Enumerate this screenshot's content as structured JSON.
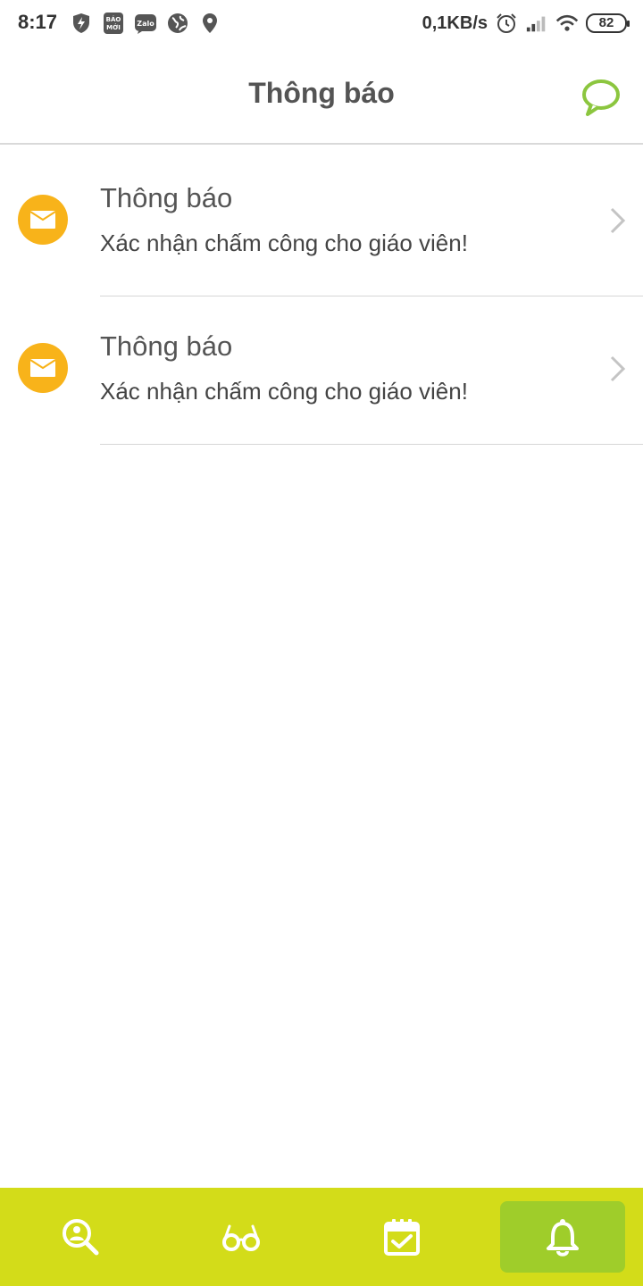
{
  "status_bar": {
    "time": "8:17",
    "network_speed": "0,1KB/s",
    "battery": "82",
    "left_icons": [
      "shield-bolt-icon",
      "bao-moi-icon",
      "zalo-icon",
      "globe-icon",
      "location-icon"
    ],
    "right_icons": [
      "alarm-icon",
      "signal-icon",
      "wifi-icon",
      "battery-icon"
    ]
  },
  "header": {
    "title": "Thông báo",
    "chat_icon": "chat-bubble-icon",
    "accent_color": "#8cc63f"
  },
  "notifications": [
    {
      "title": "Thông báo",
      "message": "Xác nhận chấm công cho giáo viên!",
      "icon": "envelope-icon"
    },
    {
      "title": "Thông báo",
      "message": "Xác nhận chấm công cho giáo viên!",
      "icon": "envelope-icon"
    }
  ],
  "colors": {
    "notification_icon_bg": "#f8b31a",
    "bottom_nav_bg": "#d3dc19",
    "bottom_nav_active_bg": "#9fcd2a"
  },
  "bottom_nav": [
    {
      "icon": "search-user-icon",
      "active": false
    },
    {
      "icon": "glasses-icon",
      "active": false
    },
    {
      "icon": "calendar-check-icon",
      "active": false
    },
    {
      "icon": "bell-icon",
      "active": true
    }
  ]
}
